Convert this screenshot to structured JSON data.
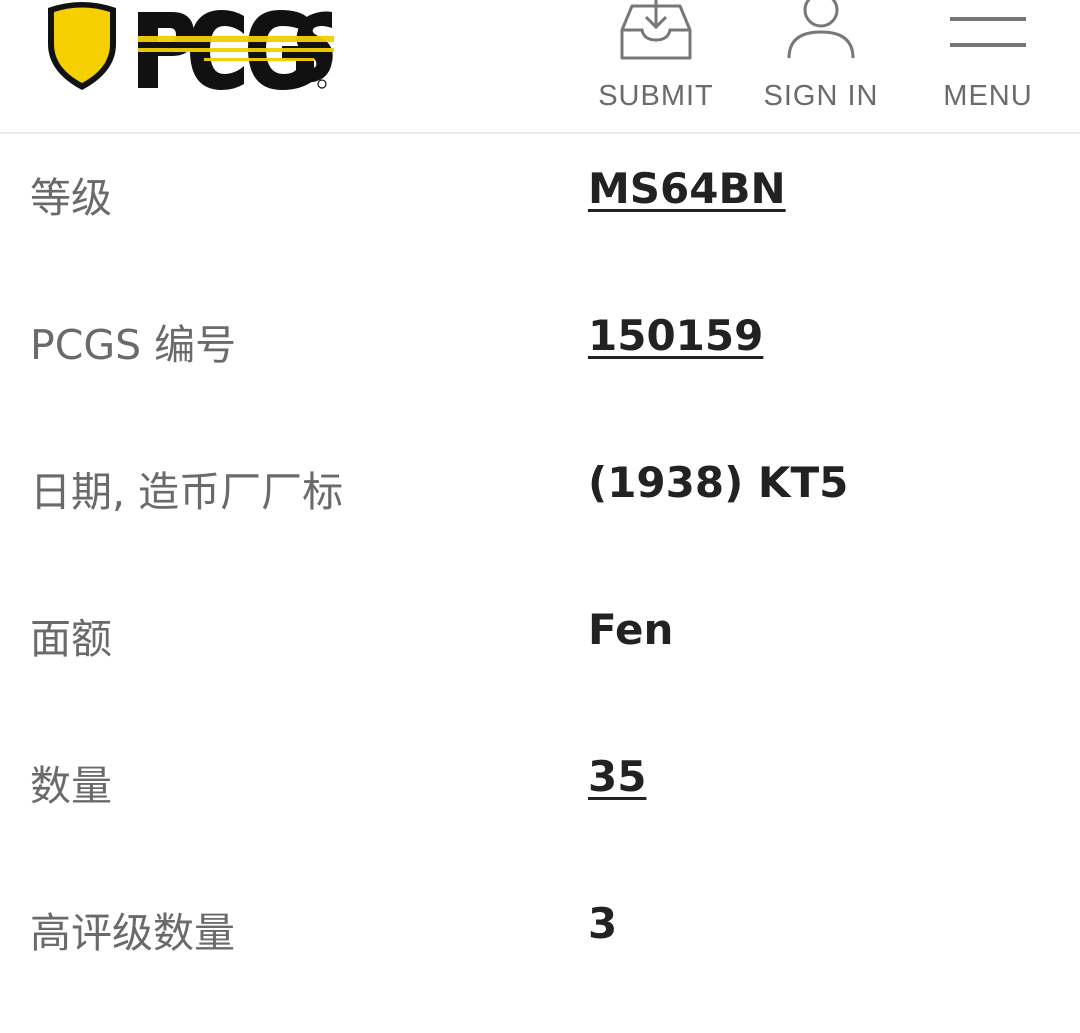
{
  "header": {
    "logo_text": "PCGS",
    "nav": [
      {
        "label": "SUBMIT",
        "icon": "inbox-download-icon"
      },
      {
        "label": "SIGN IN",
        "icon": "user-icon"
      },
      {
        "label": "MENU",
        "icon": "hamburger-icon"
      }
    ]
  },
  "colors": {
    "brand_yellow": "#f5cf00",
    "brand_black": "#111111",
    "label_gray": "#6a6a6a",
    "value_dark": "#222222"
  },
  "details": [
    {
      "label": "等级",
      "value": "MS64BN",
      "is_link": true
    },
    {
      "label": "PCGS 编号",
      "value": "150159",
      "is_link": true
    },
    {
      "label": "日期, 造币厂厂标",
      "value": "(1938) KT5",
      "is_link": false
    },
    {
      "label": "面额",
      "value": "Fen",
      "is_link": false
    },
    {
      "label": "数量",
      "value": "35",
      "is_link": true
    },
    {
      "label": "高评级数量",
      "value": "3",
      "is_link": false
    }
  ]
}
